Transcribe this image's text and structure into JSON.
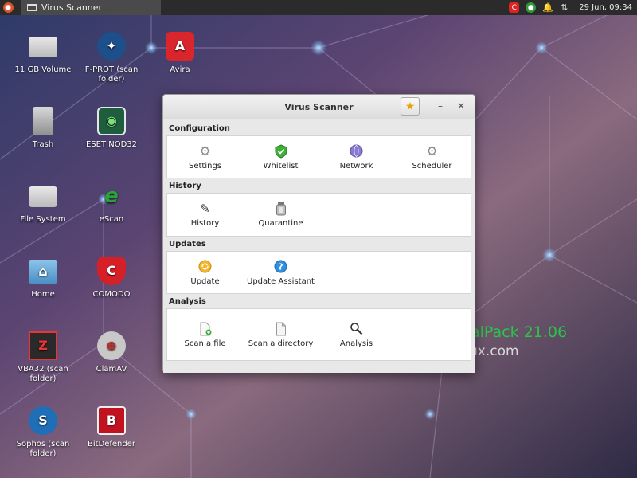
{
  "panel": {
    "taskbar_title": "Virus Scanner",
    "clock": "29 Jun, 09:34",
    "tray_icons": [
      "comodo-tray-icon",
      "green-tray-icon",
      "bell-icon",
      "network-arrows-icon"
    ]
  },
  "desktop": {
    "icons": [
      {
        "label": "11 GB Volume",
        "icon": "drive-icon"
      },
      {
        "label": "F-PROT (scan folder)",
        "icon": "fprot-icon"
      },
      {
        "label": "Avira",
        "icon": "avira-icon"
      },
      {
        "label": "Trash",
        "icon": "trash-icon"
      },
      {
        "label": "ESET NOD32",
        "icon": "eset-icon"
      },
      {
        "label": "File System",
        "icon": "drive-icon"
      },
      {
        "label": "eScan",
        "icon": "escan-icon"
      },
      {
        "label": "Home",
        "icon": "home-folder-icon"
      },
      {
        "label": "COMODO",
        "icon": "comodo-icon"
      },
      {
        "label": "VBA32 (scan folder)",
        "icon": "vba32-icon"
      },
      {
        "label": "ClamAV",
        "icon": "clamav-icon"
      },
      {
        "label": "Sophos (scan folder)",
        "icon": "sophos-icon"
      },
      {
        "label": "BitDefender",
        "icon": "bitdefender-icon"
      }
    ],
    "watermark_line1": "…alPack 21.06",
    "watermark_line2": "…ux.com"
  },
  "window": {
    "title": "Virus Scanner",
    "sections": [
      {
        "header": "Configuration",
        "tools": [
          {
            "label": "Settings",
            "icon": "gear-icon"
          },
          {
            "label": "Whitelist",
            "icon": "shield-check-icon"
          },
          {
            "label": "Network",
            "icon": "globe-icon"
          },
          {
            "label": "Scheduler",
            "icon": "gear-icon"
          }
        ]
      },
      {
        "header": "History",
        "tools": [
          {
            "label": "History",
            "icon": "pencil-icon"
          },
          {
            "label": "Quarantine",
            "icon": "jar-icon"
          }
        ]
      },
      {
        "header": "Updates",
        "tools": [
          {
            "label": "Update",
            "icon": "refresh-icon"
          },
          {
            "label": "Update Assistant",
            "icon": "help-icon"
          }
        ]
      },
      {
        "header": "Analysis",
        "tools": [
          {
            "label": "Scan a file",
            "icon": "file-add-icon"
          },
          {
            "label": "Scan a directory",
            "icon": "document-icon"
          },
          {
            "label": "Analysis",
            "icon": "magnifier-icon"
          }
        ]
      }
    ]
  },
  "colors": {
    "accent_red": "#d9532b",
    "window_bg": "#e8e8e8"
  }
}
